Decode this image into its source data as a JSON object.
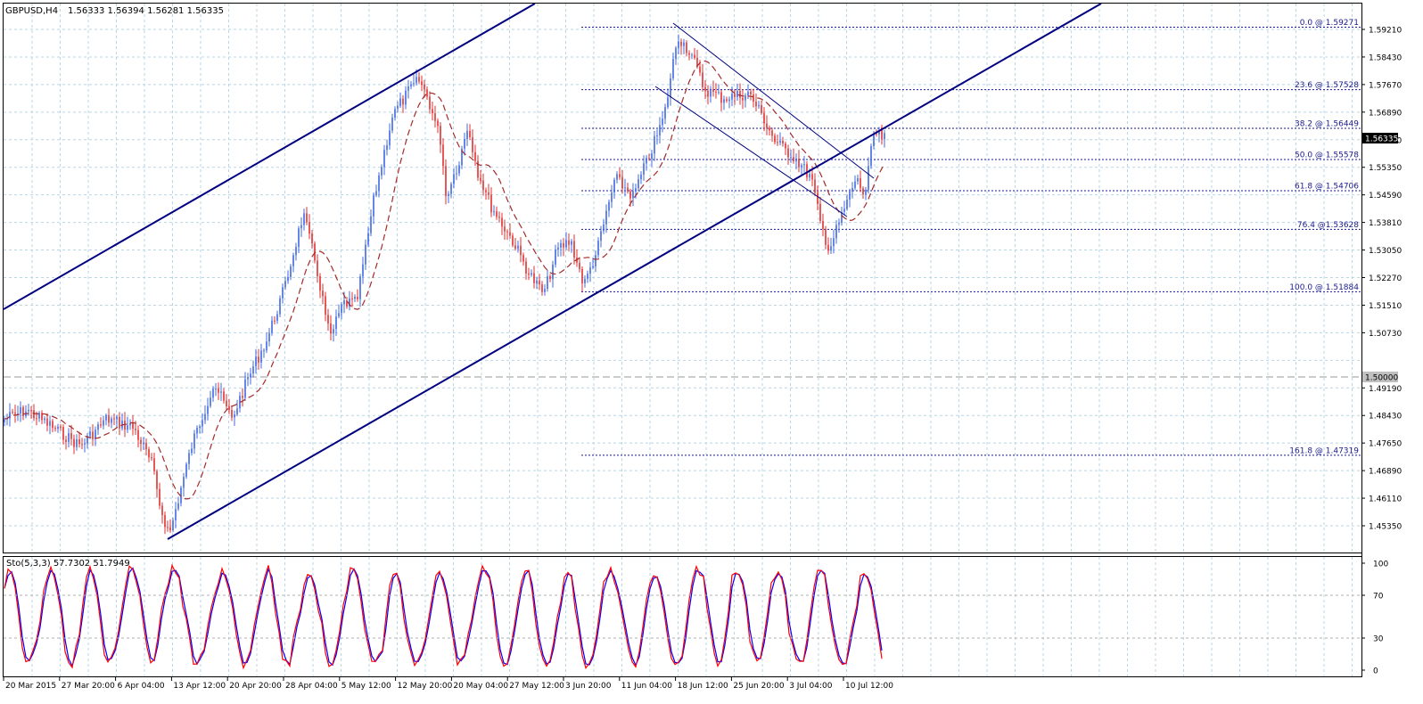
{
  "header": {
    "symbol_tf": "GBPUSD,H4",
    "ohlc": "1.56333 1.56394 1.56281 1.56335"
  },
  "price_axis": {
    "labels": [
      "1.59210",
      "1.58430",
      "1.57670",
      "1.56890",
      "1.56130",
      "1.55350",
      "1.54590",
      "1.53810",
      "1.53050",
      "1.52270",
      "1.51510",
      "1.50730",
      "1.50000",
      "1.49190",
      "1.48430",
      "1.47650",
      "1.46890",
      "1.46110",
      "1.45350"
    ],
    "current": "1.56335",
    "level_1500": "1.50000"
  },
  "fibonacci": {
    "levels": [
      {
        "label": "0.0 @ 1.59271",
        "price": 1.59271
      },
      {
        "label": "23.6 @ 1.57528",
        "price": 1.57528
      },
      {
        "label": "38.2 @ 1.56449",
        "price": 1.56449
      },
      {
        "label": "50.0 @ 1.55578",
        "price": 1.55578
      },
      {
        "label": "61.8 @ 1.54706",
        "price": 1.54706
      },
      {
        "label": "76.4 @1.53628",
        "price": 1.53628
      },
      {
        "label": "100.0 @ 1.51884",
        "price": 1.51884
      },
      {
        "label": "161.8 @ 1.47319",
        "price": 1.47319
      }
    ]
  },
  "stochastic": {
    "label": "Sto(5,3,3) 57.7302 51.7949",
    "axis": [
      "100",
      "70",
      "30",
      "0"
    ]
  },
  "time_axis": {
    "labels": [
      "20 Mar 2015",
      "27 Mar 20:00",
      "6 Apr 04:00",
      "13 Apr 12:00",
      "20 Apr 20:00",
      "28 Apr 04:00",
      "5 May 12:00",
      "12 May 20:00",
      "20 May 04:00",
      "27 May 12:00",
      "3 Jun 20:00",
      "11 Jun 04:00",
      "18 Jun 12:00",
      "25 Jun 20:00",
      "3 Jul 04:00",
      "10 Jul 12:00"
    ]
  },
  "colors": {
    "bull": "#4169e1",
    "bear": "#e03030",
    "ma": "#a52a2a",
    "trend": "#000080",
    "grid": "#b8d6e6",
    "fib": "#1a1a8c",
    "stoch_main": "#ff0000",
    "stoch_signal": "#0000ff"
  }
}
